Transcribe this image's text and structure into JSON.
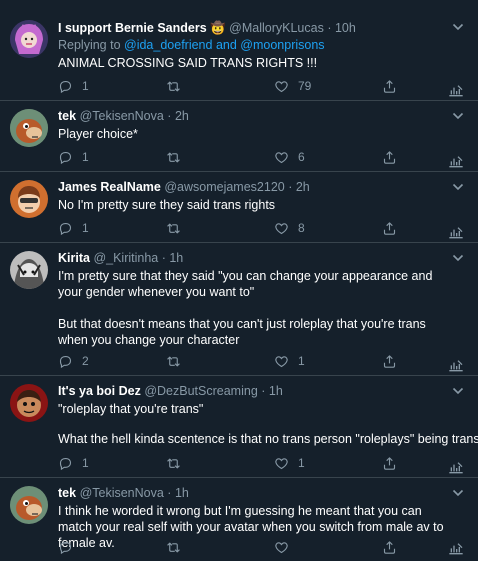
{
  "tweets": [
    {
      "display_name": "I support Bernie Sanders 🤠",
      "handle": "@MalloryKLucas",
      "time": "10h",
      "replying_prefix": "Replying to ",
      "replying_user1": "@ida_doefriend",
      "replying_and": " and ",
      "replying_user2": "@moonprisons",
      "text": "ANIMAL CROSSING SAID TRANS RIGHTS !!!",
      "replies": "1",
      "retweets": "",
      "likes": "79"
    },
    {
      "display_name": "tek",
      "handle": "@TekisenNova",
      "time": "2h",
      "text": "Player choice*",
      "replies": "1",
      "retweets": "",
      "likes": "6"
    },
    {
      "display_name": "James RealName",
      "handle": "@awsomejames2120",
      "time": "2h",
      "text": "No I'm pretty sure they said trans rights",
      "replies": "1",
      "retweets": "",
      "likes": "8"
    },
    {
      "display_name": "Kirita",
      "handle": "@_Kiritinha",
      "time": "1h",
      "text1": "I'm pretty sure that they said \"you can change your appearance and your gender whenever you want to\"",
      "text2": "But that doesn't means that you can't just roleplay that you're trans when you change your character",
      "replies": "2",
      "retweets": "",
      "likes": "1"
    },
    {
      "display_name": "It's ya boi Dez",
      "handle": "@DezButScreaming",
      "time": "1h",
      "text1": "\"roleplay that you're trans\"",
      "text2": "What the hell kinda scentence is that no trans person \"roleplays\" being trans.",
      "replies": "1",
      "retweets": "",
      "likes": "1"
    },
    {
      "display_name": "tek",
      "handle": "@TekisenNova",
      "time": "1h",
      "text": "I think he  worded it wrong but I'm guessing he meant that you can match your real self with your avatar when you switch from male av to female av.",
      "replies": "",
      "retweets": "",
      "likes": ""
    }
  ],
  "separator": " · ",
  "colors": {
    "background": "#15202b",
    "secondary_text": "#8899a6",
    "link": "#1da1f2",
    "divider": "#38444d"
  },
  "icons": [
    "reply-icon",
    "retweet-icon",
    "like-icon",
    "share-icon",
    "analytics-icon",
    "chevron-down-icon"
  ]
}
